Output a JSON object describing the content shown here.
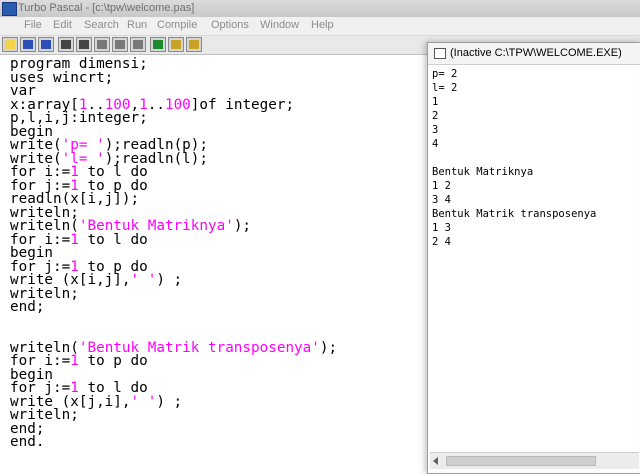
{
  "window": {
    "title": "Turbo Pascal - [c:\\tpw\\welcome.pas]",
    "faint_title": "Turbo Pascal - [c:\\tpw\\welcome.pas]"
  },
  "menu": [
    "File",
    "Edit",
    "Search",
    "Run",
    "Compile",
    "Options",
    "Window",
    "Help"
  ],
  "toolbar": {
    "buttons": [
      "help-icon",
      "open-icon",
      "save-icon",
      "search-icon",
      "replace-icon",
      "cut-icon",
      "copy-icon",
      "paste-icon",
      "undo-icon",
      "compile-icon",
      "run-icon"
    ]
  },
  "editor": {
    "lines": [
      [
        "program dimensi;"
      ],
      [
        "uses wincrt;"
      ],
      [
        "var"
      ],
      [
        "x:array[",
        {
          "n": "1"
        },
        "..",
        {
          "n": "100"
        },
        ",",
        {
          "n": "1"
        },
        "..",
        {
          "n": "100"
        },
        "]of integer;"
      ],
      [
        "p,l,i,j:integer;"
      ],
      [
        "begin"
      ],
      [
        "write(",
        {
          "s": "'p= '"
        },
        ");readln(p);"
      ],
      [
        "write(",
        {
          "s": "'l= '"
        },
        ");readln(l);"
      ],
      [
        "for i:=",
        {
          "n": "1"
        },
        " to l do"
      ],
      [
        "for j:=",
        {
          "n": "1"
        },
        " to p do"
      ],
      [
        "readln(x[i,j]);"
      ],
      [
        "writeln;"
      ],
      [
        "writeln(",
        {
          "s": "'Bentuk Matriknya'"
        },
        ");"
      ],
      [
        "for i:=",
        {
          "n": "1"
        },
        " to l do"
      ],
      [
        "begin"
      ],
      [
        "for j:=",
        {
          "n": "1"
        },
        " to p do"
      ],
      [
        "write (x[i,j],",
        {
          "s": "' '"
        },
        ") ;"
      ],
      [
        "writeln;"
      ],
      [
        "end;"
      ],
      [
        ""
      ],
      [
        ""
      ],
      [
        "writeln(",
        {
          "s": "'Bentuk Matrik transposenya'"
        },
        ");"
      ],
      [
        "for i:=",
        {
          "n": "1"
        },
        " to p do"
      ],
      [
        "begin"
      ],
      [
        "for j:=",
        {
          "n": "1"
        },
        " to l do"
      ],
      [
        "write (x[j,i],",
        {
          "s": "' '"
        },
        ") ;"
      ],
      [
        "writeln;"
      ],
      [
        "end;"
      ],
      [
        "end."
      ]
    ]
  },
  "wincrt": {
    "title": "(Inactive C:\\TPW\\WELCOME.EXE)",
    "output": [
      "p= 2",
      "l= 2",
      "1",
      "2",
      "3",
      "4",
      "",
      "Bentuk Matriknya",
      "1 2",
      "3 4",
      "Bentuk Matrik transposenya",
      "1 3",
      "2 4"
    ]
  }
}
